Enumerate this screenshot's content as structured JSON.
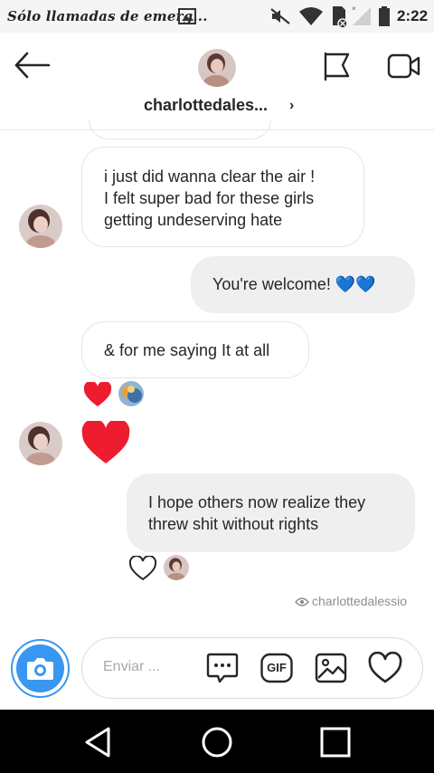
{
  "status_bar": {
    "carrier_text": "Sólo llamadas de emerg...",
    "time": "2:22"
  },
  "header": {
    "username": "charlottedales...",
    "chevron": "›",
    "icons": [
      "back-arrow-icon",
      "flag-icon",
      "video-camera-icon"
    ]
  },
  "messages": [
    {
      "side": "received",
      "text": "i just did wanna clear the air !\nI felt super bad for these girls\ngetting undeserving hate",
      "show_avatar": true
    },
    {
      "side": "sent",
      "text": "You're welcome! 💙💙"
    },
    {
      "side": "received",
      "text": "& for me saying It at all",
      "reactions": [
        "red-heart",
        "reactor-avatar"
      ]
    },
    {
      "side": "received",
      "type": "heart",
      "show_avatar": true
    },
    {
      "side": "sent",
      "text": "I hope others now realize they\nthrew shit without rights",
      "reactions": [
        "heart-outline",
        "reactor-avatar"
      ]
    }
  ],
  "seen": {
    "label": "charlottedalessio"
  },
  "composer": {
    "placeholder": "Enviar ...",
    "gif_label": "GIF"
  },
  "colors": {
    "accent": "#3897f0",
    "heart": "#ed1c2e",
    "sent_bubble": "#efefef",
    "blue_heart": "#3d9ee5"
  }
}
